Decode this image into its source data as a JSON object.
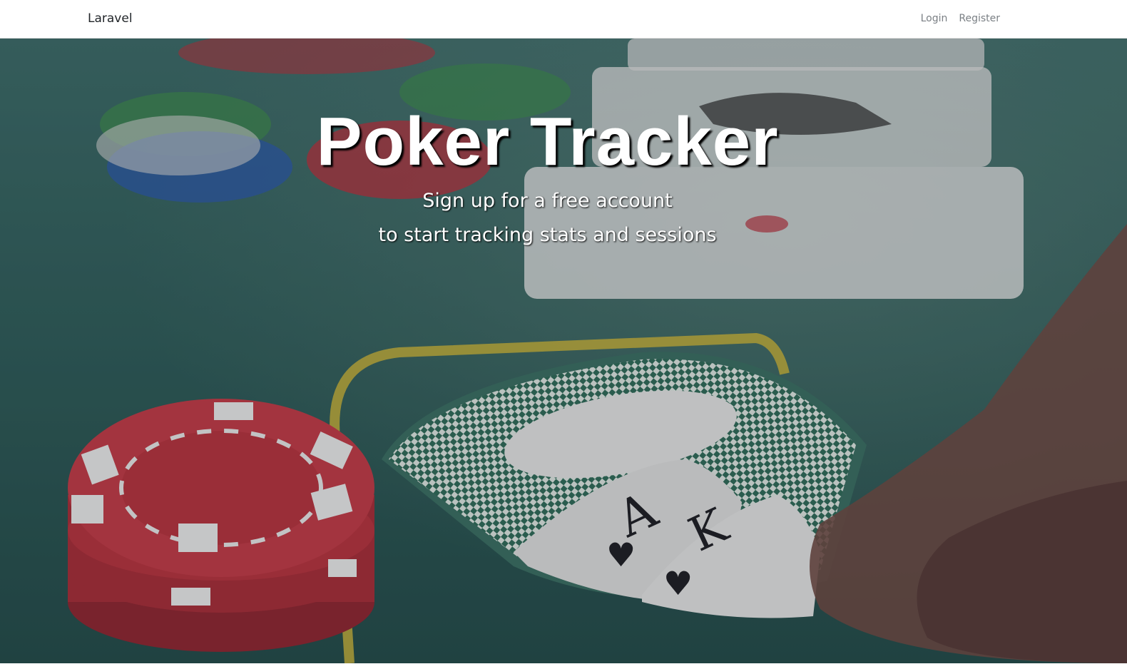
{
  "navbar": {
    "brand": "Laravel",
    "links": [
      {
        "label": "Login"
      },
      {
        "label": "Register"
      }
    ]
  },
  "hero": {
    "title": "Poker Tracker",
    "subtitle_line1": "Sign up for a free account",
    "subtitle_line2": "to start tracking stats and sessions",
    "background_image": "poker-table-chips-cards-photo"
  },
  "colors": {
    "felt": "#2e5c5a",
    "chip_red": "#b8323e",
    "chip_green": "#3d8a4e",
    "chip_blue": "#2d5aa8",
    "text": "#ffffff"
  }
}
